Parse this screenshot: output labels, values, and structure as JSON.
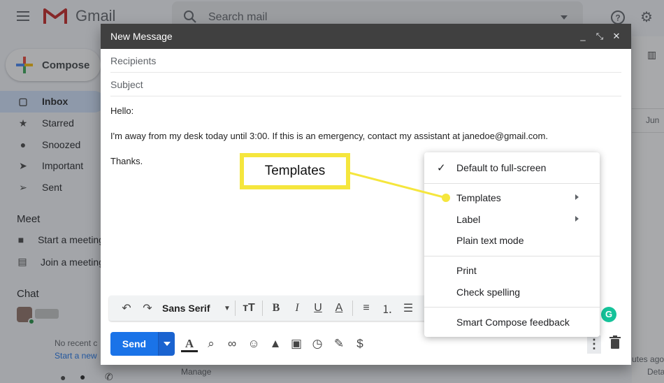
{
  "app": {
    "logo_text": "Gmail",
    "search_placeholder": "Search mail",
    "compose_label": "Compose"
  },
  "nav": {
    "items": [
      {
        "label": "Inbox",
        "icon": "inbox-icon",
        "active": true
      },
      {
        "label": "Starred",
        "icon": "star-icon"
      },
      {
        "label": "Snoozed",
        "icon": "clock-icon"
      },
      {
        "label": "Important",
        "icon": "important-icon"
      },
      {
        "label": "Sent",
        "icon": "send-icon"
      }
    ],
    "meet_title": "Meet",
    "meet_items": [
      {
        "label": "Start a meeting",
        "icon": "video-icon"
      },
      {
        "label": "Join a meeting",
        "icon": "keyboard-icon"
      }
    ],
    "chat_title": "Chat",
    "no_recent": "No recent c",
    "start_new": "Start a new",
    "manage": "Manage",
    "date_fragment": "Jun",
    "bottom_right_1": "utes ago",
    "bottom_right_2": "Deta"
  },
  "compose": {
    "title": "New Message",
    "recipients_placeholder": "Recipients",
    "subject_placeholder": "Subject",
    "body_lines": [
      "Hello:",
      "I'm away from my desk today until 3:00. If this is an emergency, contact my assistant at janedoe@gmail.com.",
      "Thanks."
    ],
    "font_name": "Sans Serif",
    "send_label": "Send"
  },
  "menu": {
    "items": [
      {
        "label": "Default to full-screen",
        "checked": true
      },
      {
        "label": "Templates",
        "submenu": true
      },
      {
        "label": "Label",
        "submenu": true
      },
      {
        "label": "Plain text mode"
      },
      {
        "label": "Print"
      },
      {
        "label": "Check spelling"
      },
      {
        "label": "Smart Compose feedback"
      }
    ]
  },
  "callout": {
    "label": "Templates",
    "color": "#f5e63d"
  },
  "colors": {
    "send_blue": "#1a73e8",
    "header_dark": "#404040",
    "grammarly_green": "#15c39a"
  }
}
